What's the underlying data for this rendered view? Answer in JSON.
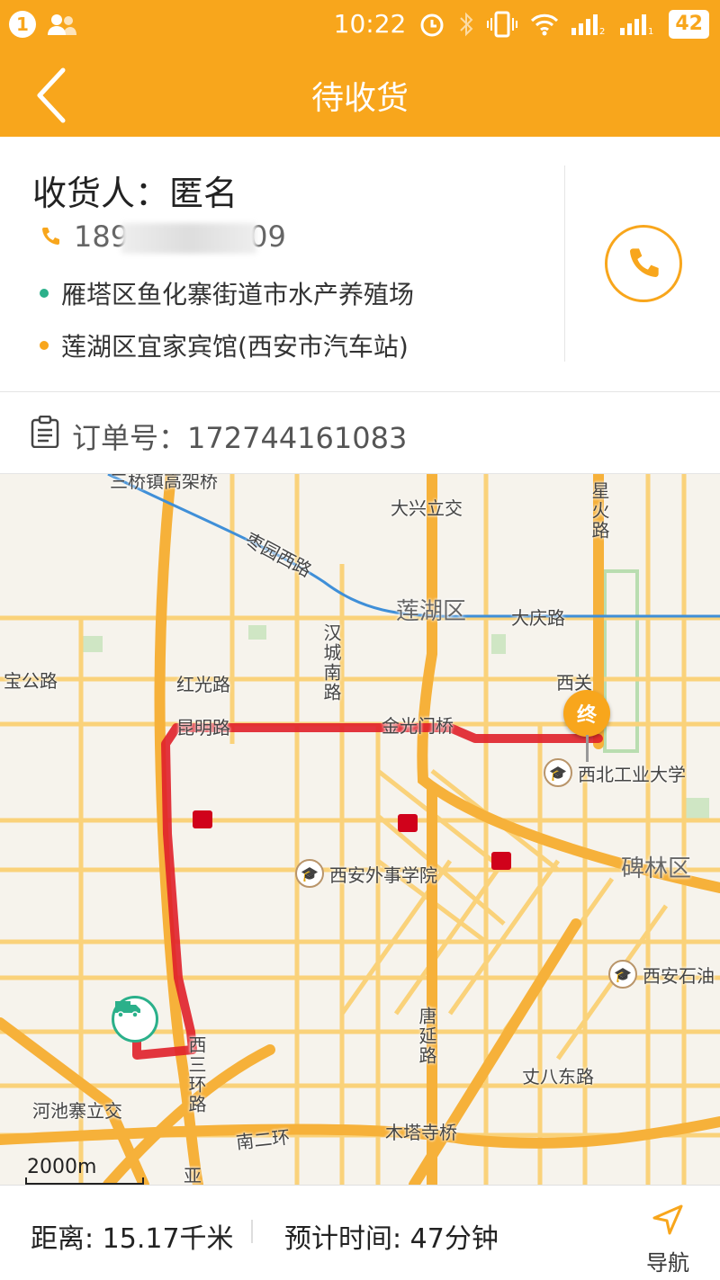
{
  "status_bar": {
    "notification_count": "1",
    "time": "10:22",
    "battery": "42"
  },
  "header": {
    "title": "待收货"
  },
  "receiver": {
    "label": "收货人：",
    "name": "匿名",
    "phone_prefix": "189",
    "phone_suffix": "09",
    "address_from": "雁塔区鱼化寨街道市水产养殖场",
    "address_to": "莲湖区宜家宾馆(西安市汽车站)"
  },
  "order": {
    "label": "订单号：",
    "number": "172744161083"
  },
  "map": {
    "labels": {
      "qiaozhen": "三桥镇高架桥",
      "daxing": "大兴立交",
      "xinghuo": "星火路",
      "zaoyuan": "枣园西路",
      "lianhu": "莲湖区",
      "daqing": "大庆路",
      "baogong": "宝公路",
      "hongguang": "红光路",
      "hancheng": "汉城南路",
      "xiguan": "西关",
      "kunming": "昆明路",
      "jinguangmen": "金光门桥",
      "tangyan": "唐延路",
      "nwpu": "西北工业大学",
      "beilin": "碑林区",
      "waishi": "西安外事学院",
      "xishiyou": "西安石油",
      "zhangba": "丈八东路",
      "hechizhai": "河池寨立交",
      "xisanhuan": "西三环路",
      "nanerhuan": "南二环",
      "mutasi": "木塔寺桥",
      "ya": "亚"
    },
    "destination_marker": "终",
    "scale": "2000m",
    "colors": {
      "route": "#e0202a",
      "major_road": "#f6b13a",
      "minor_road": "#fad27a",
      "rail": "#3f8fd8"
    }
  },
  "bottom": {
    "distance_label": "距离:",
    "distance": "15.17千米",
    "eta_label": "预计时间:",
    "eta": "47分钟",
    "nav_label": "导航"
  }
}
